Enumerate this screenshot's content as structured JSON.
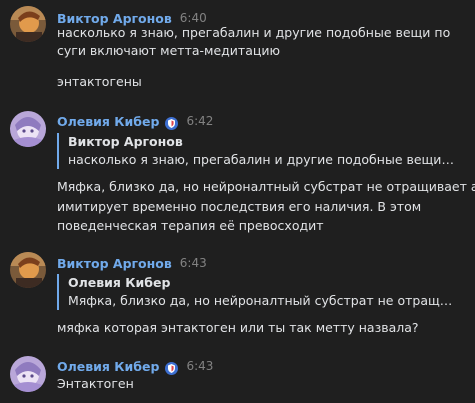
{
  "colors": {
    "background": "#1f1f1f",
    "author": "#71aaeb",
    "text": "#e1e3e6",
    "muted": "#828282"
  },
  "messages": [
    {
      "author": "Виктор Аргонов",
      "time": "6:40",
      "lines": [
        "насколько я знаю, прегабалин и другие подобные вещи по",
        "суги включают метта-медитацию"
      ],
      "extra": "энтактогены"
    },
    {
      "author": "Олевия Кибер",
      "time": "6:42",
      "badge": "shield-badge-icon",
      "quote": {
        "author": "Виктор Аргонов",
        "text": "насколько я знаю, прегабалин и другие подобные вещи по ..."
      },
      "lines": [
        "Мяфка, близко да, но нейроналтный субстрат не отращивает а",
        "имитирует временно последствия его наличия. В этом",
        "поведенческая терапия её превосходит"
      ]
    },
    {
      "author": "Виктор Аргонов",
      "time": "6:43",
      "quote": {
        "author": "Олевия Кибер",
        "text": "Мяфка, близко да, но нейроналтный субстрат не отращивае..."
      },
      "lines": [
        "мяфка которая энтактоген или ты так метту назвала?"
      ]
    },
    {
      "author": "Олевия Кибер",
      "time": "6:43",
      "badge": "shield-badge-icon",
      "lines": [
        "Энтактоген"
      ]
    }
  ]
}
